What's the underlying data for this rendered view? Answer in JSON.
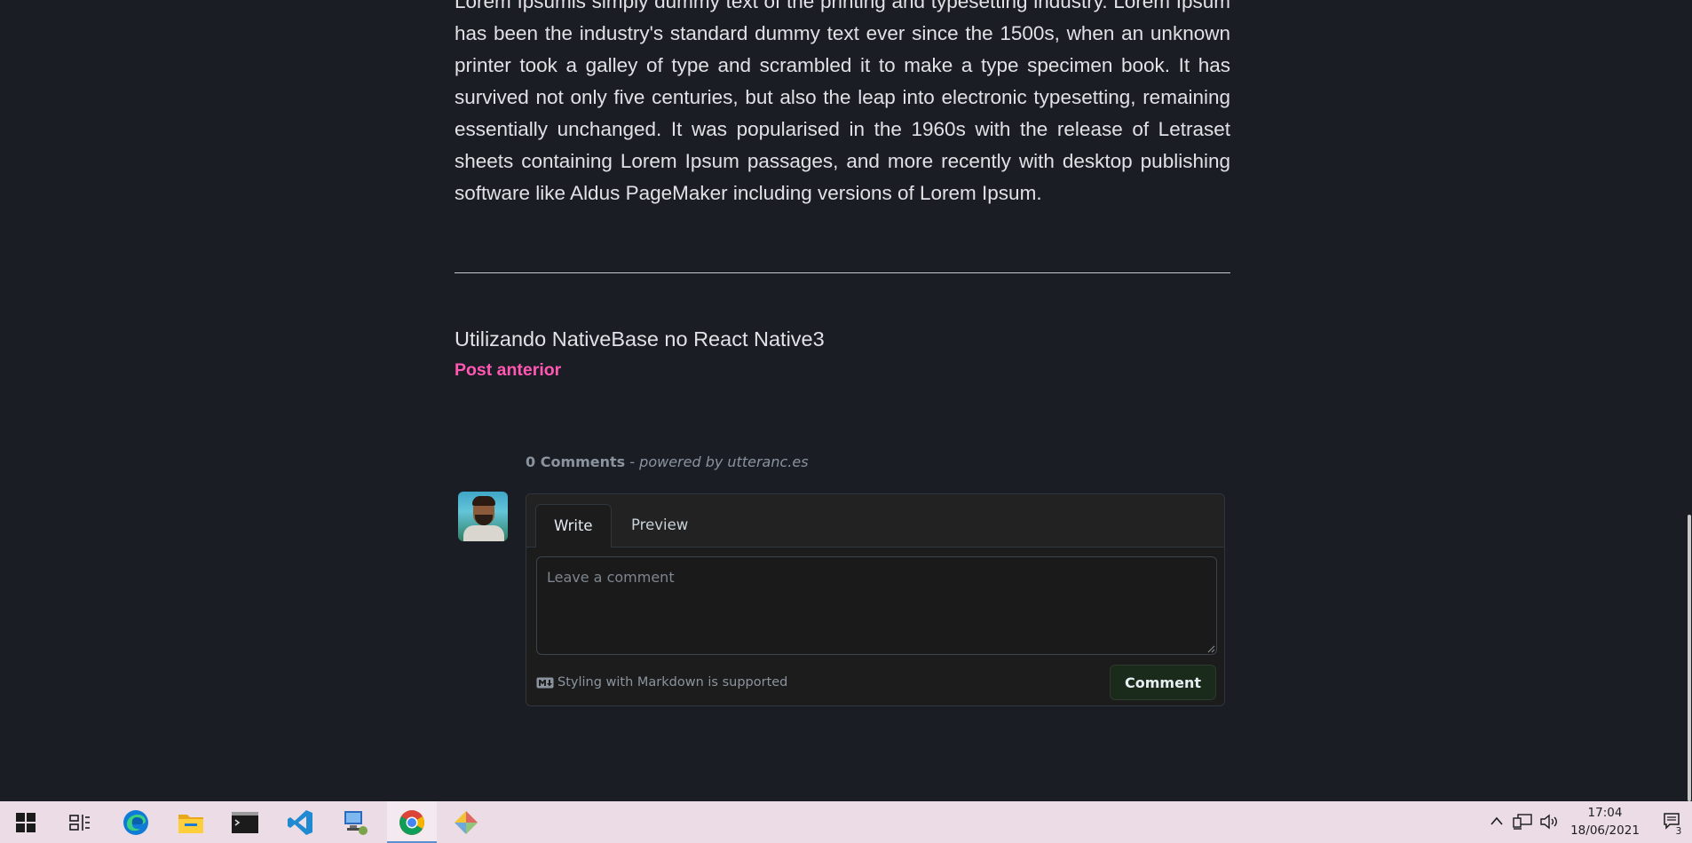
{
  "article": {
    "body": "Lorem Ipsumis simply dummy text of the printing and typesetting industry. Lorem Ipsum has been the industry's standard dummy text ever since the 1500s, when an unknown printer took a galley of type and scrambled it to make a type specimen book. It has survived not only five centuries, but also the leap into electronic typesetting, remaining essentially unchanged. It was popularised in the 1960s with the release of Letraset sheets containing Lorem Ipsum passages, and more recently with desktop publishing software like Aldus PageMaker including versions of Lorem Ipsum."
  },
  "navigation": {
    "previous_post_title": "Utilizando NativeBase no React Native3",
    "previous_post_label": "Post anterior"
  },
  "comments": {
    "count_label": "0 Comments",
    "powered_by": "- powered by utteranc.es",
    "tabs": [
      {
        "label": "Write",
        "active": true
      },
      {
        "label": "Preview",
        "active": false
      }
    ],
    "textarea_value": "",
    "textarea_placeholder": "Leave a comment",
    "markdown_note": "Styling with Markdown is supported",
    "submit_label": "Comment"
  },
  "taskbar": {
    "apps": [
      {
        "icon": "windows-start-icon"
      },
      {
        "icon": "task-view-icon"
      },
      {
        "icon": "edge-icon"
      },
      {
        "icon": "file-explorer-icon"
      },
      {
        "icon": "terminal-icon"
      },
      {
        "icon": "vscode-icon"
      },
      {
        "icon": "remote-desktop-icon"
      },
      {
        "icon": "chrome-icon",
        "active": true
      },
      {
        "icon": "git-kraken-icon"
      }
    ],
    "tray": {
      "time": "17:04",
      "date": "18/06/2021",
      "notification_count": "3"
    }
  },
  "colors": {
    "page_background": "#1a1d24",
    "accent_pink": "#ff57b2",
    "comment_button_bg": "#1a2b1c",
    "taskbar_background": "#ebdce5"
  }
}
